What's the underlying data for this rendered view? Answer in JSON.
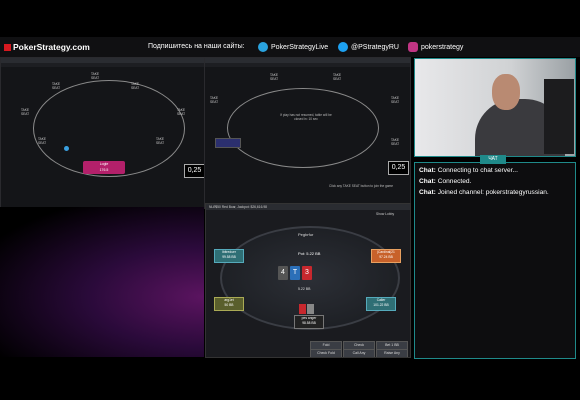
{
  "banner": {
    "logo": "PokerStrategy.com",
    "subscribe": "Подпишитесь на наши сайты:",
    "telegram": "PokerStrategyLive",
    "twitter": "@PStrategyRU",
    "instagram": "pokerstrategy",
    "colors": {
      "telegram": "#2aa3df",
      "twitter": "#1da1f2",
      "instagram": "#c13584",
      "logo_red": "#d71920"
    }
  },
  "table1": {
    "seats": [
      "TAKE SEAT",
      "TAKE SEAT",
      "TAKE SEAT",
      "TAKE SEAT",
      "TAKE SEAT",
      "TAKE SEAT",
      "TAKE SEAT",
      "TAKE SEAT",
      "TAKE SEAT"
    ],
    "hero_name": "Logle",
    "hero_stack": "176.5",
    "bet": "0,25"
  },
  "table2": {
    "notice_line1": "If play has not resumed, table will be",
    "notice_line2": "closed in: 10 sec",
    "seats": [
      "TAKE SEAT",
      "TAKE SEAT",
      "TAKE SEAT",
      "TAKE SEAT",
      "TAKE SEAT",
      "TAKE SEAT",
      "TAKE SEAT"
    ],
    "footer": "Click any TAKE SEAT button to join the game",
    "bet": "0,25"
  },
  "client": {
    "title": "NL₽$50 Red Boar, Jackpot: $26,616.98",
    "table_name": "Pegbrfur",
    "pot": "Pot: 5.22 BB",
    "community": [
      {
        "rank": "4",
        "color": "#444"
      },
      {
        "rank": "T",
        "color": "#2b6fb8"
      },
      {
        "rank": "3",
        "color": "#c8282e"
      }
    ],
    "subpot": "5.22 BB",
    "players": [
      {
        "name": "Ibitreduer",
        "stack": "99.58 BB"
      },
      {
        "name": "|Cardinal|21",
        "stack": "97.24 BB"
      },
      {
        "name": "arg1et",
        "stack": "50 BB"
      },
      {
        "name": "Caller",
        "stack": "101.22 BB"
      },
      {
        "name": "pes anger",
        "stack": "98.58 BB"
      }
    ],
    "actions": [
      "Fold",
      "Check",
      "Bet 1 BB",
      "Check Fold",
      "Call Any",
      "Raise Any"
    ],
    "show_lobby": "Show Lobby"
  },
  "chat": {
    "header": "ЧАТ",
    "lines": [
      {
        "who": "Chat:",
        "msg": "Connecting to chat server..."
      },
      {
        "who": "Chat:",
        "msg": "Connected."
      },
      {
        "who": "Chat:",
        "msg": "Joined channel: pokerstrategyrussian."
      }
    ]
  }
}
